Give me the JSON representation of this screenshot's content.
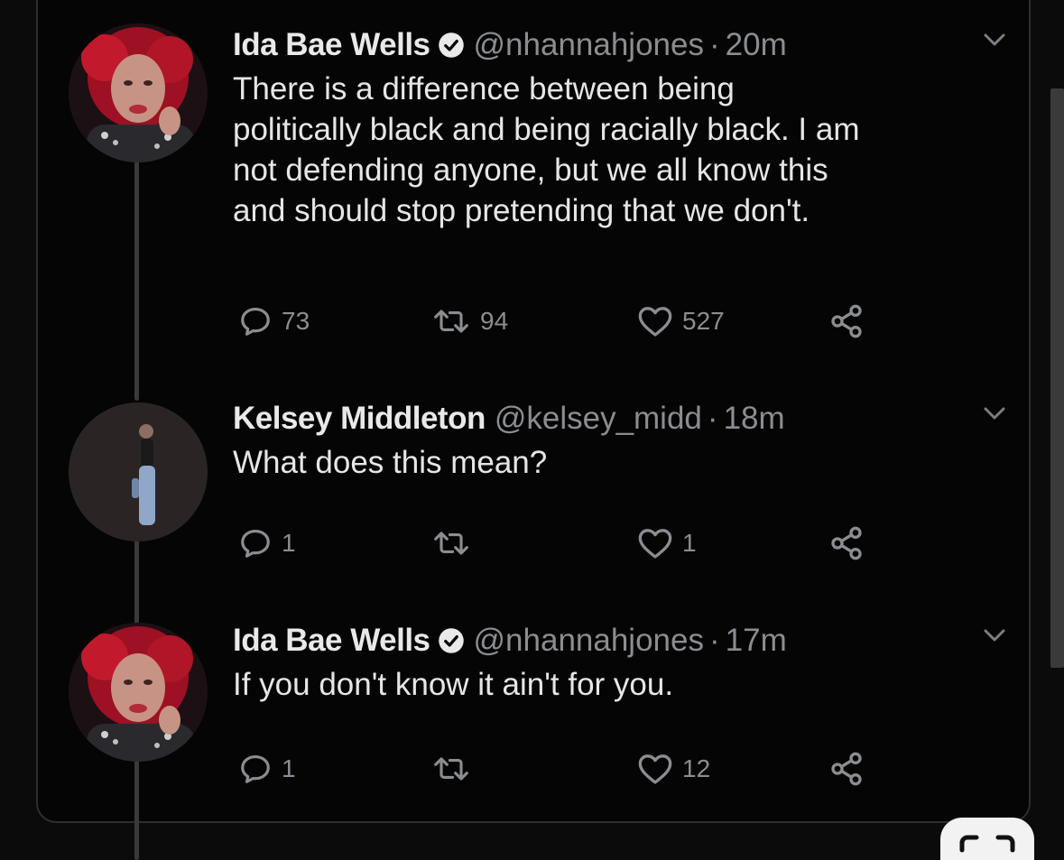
{
  "tweets": [
    {
      "name": "Ida Bae Wells",
      "verified": true,
      "handle": "@nhannahjones",
      "separator": "·",
      "time": "20m",
      "lines": [
        "There is a difference between being",
        "politically black and being racially black. I am",
        "not defending anyone, but we all know this",
        "and should stop pretending that we don't."
      ],
      "replies": "73",
      "retweets": "94",
      "likes": "527"
    },
    {
      "name": "Kelsey Middleton",
      "verified": false,
      "handle": "@kelsey_midd",
      "separator": "·",
      "time": "18m",
      "lines": [
        "What does this mean?"
      ],
      "replies": "1",
      "retweets": "",
      "likes": "1"
    },
    {
      "name": "Ida Bae Wells",
      "verified": true,
      "handle": "@nhannahjones",
      "separator": "·",
      "time": "17m",
      "lines": [
        "If you don't know it ain't for you."
      ],
      "replies": "1",
      "retweets": "",
      "likes": "12"
    }
  ],
  "icons": {
    "reply": "speech-bubble-icon",
    "retweet": "retweet-arrows-icon",
    "like": "heart-icon",
    "share": "share-icon",
    "more": "chevron-down-icon",
    "verified": "verified-badge-icon"
  },
  "colors": {
    "background": "#0b0b0b",
    "text": "#e6e6e6",
    "secondary": "#8a8d91",
    "thread_line": "#3a3a3a"
  }
}
